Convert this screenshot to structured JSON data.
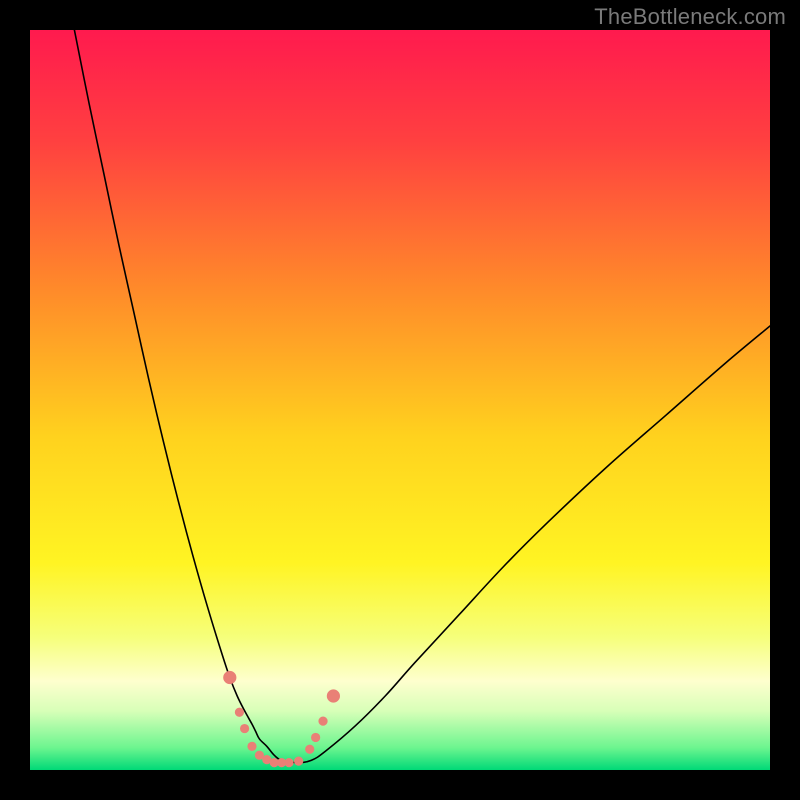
{
  "watermark": "TheBottleneck.com",
  "chart_data": {
    "type": "line",
    "title": "",
    "xlabel": "",
    "ylabel": "",
    "xlim": [
      0,
      100
    ],
    "ylim": [
      0,
      100
    ],
    "grid": false,
    "legend": {
      "visible": false
    },
    "background_gradient": {
      "stops": [
        {
          "offset": 0.0,
          "color": "#FF1A4E"
        },
        {
          "offset": 0.15,
          "color": "#FF4040"
        },
        {
          "offset": 0.35,
          "color": "#FF8A2A"
        },
        {
          "offset": 0.55,
          "color": "#FFD21E"
        },
        {
          "offset": 0.72,
          "color": "#FFF423"
        },
        {
          "offset": 0.82,
          "color": "#F6FF7A"
        },
        {
          "offset": 0.88,
          "color": "#FEFFCE"
        },
        {
          "offset": 0.92,
          "color": "#D8FFB8"
        },
        {
          "offset": 0.97,
          "color": "#6CF58F"
        },
        {
          "offset": 1.0,
          "color": "#00D977"
        }
      ]
    },
    "series": [
      {
        "name": "bottleneck-curve",
        "stroke": "#000000",
        "stroke_width": 1.6,
        "x": [
          6,
          8,
          10,
          12,
          14,
          16,
          18,
          20,
          22,
          24,
          26,
          27,
          28,
          29,
          30,
          30.5,
          31,
          32,
          33,
          34,
          36,
          38,
          40,
          44,
          48,
          52,
          58,
          64,
          70,
          78,
          86,
          94,
          100
        ],
        "y": [
          100,
          90,
          80.5,
          71,
          62,
          53,
          44.5,
          36.5,
          29,
          22,
          15.5,
          12.5,
          10,
          8,
          6.2,
          5.2,
          4.2,
          3.2,
          2,
          1.3,
          1,
          1.3,
          2.6,
          6,
          10,
          14.5,
          21,
          27.5,
          33.5,
          41,
          48,
          55,
          60
        ]
      }
    ],
    "markers": {
      "name": "highlight-points",
      "fill": "#E98076",
      "radius_small": 4.6,
      "radius_large": 6.6,
      "points": [
        {
          "x": 27.0,
          "y": 12.5,
          "size": "large"
        },
        {
          "x": 28.3,
          "y": 7.8,
          "size": "small"
        },
        {
          "x": 29.0,
          "y": 5.6,
          "size": "small"
        },
        {
          "x": 30.0,
          "y": 3.2,
          "size": "small"
        },
        {
          "x": 31.0,
          "y": 2.0,
          "size": "small"
        },
        {
          "x": 32.0,
          "y": 1.4,
          "size": "small"
        },
        {
          "x": 33.0,
          "y": 1.0,
          "size": "small"
        },
        {
          "x": 34.0,
          "y": 1.0,
          "size": "small"
        },
        {
          "x": 35.0,
          "y": 1.0,
          "size": "small"
        },
        {
          "x": 36.3,
          "y": 1.2,
          "size": "small"
        },
        {
          "x": 37.8,
          "y": 2.8,
          "size": "small"
        },
        {
          "x": 38.6,
          "y": 4.4,
          "size": "small"
        },
        {
          "x": 39.6,
          "y": 6.6,
          "size": "small"
        },
        {
          "x": 41.0,
          "y": 10.0,
          "size": "large"
        }
      ]
    }
  }
}
